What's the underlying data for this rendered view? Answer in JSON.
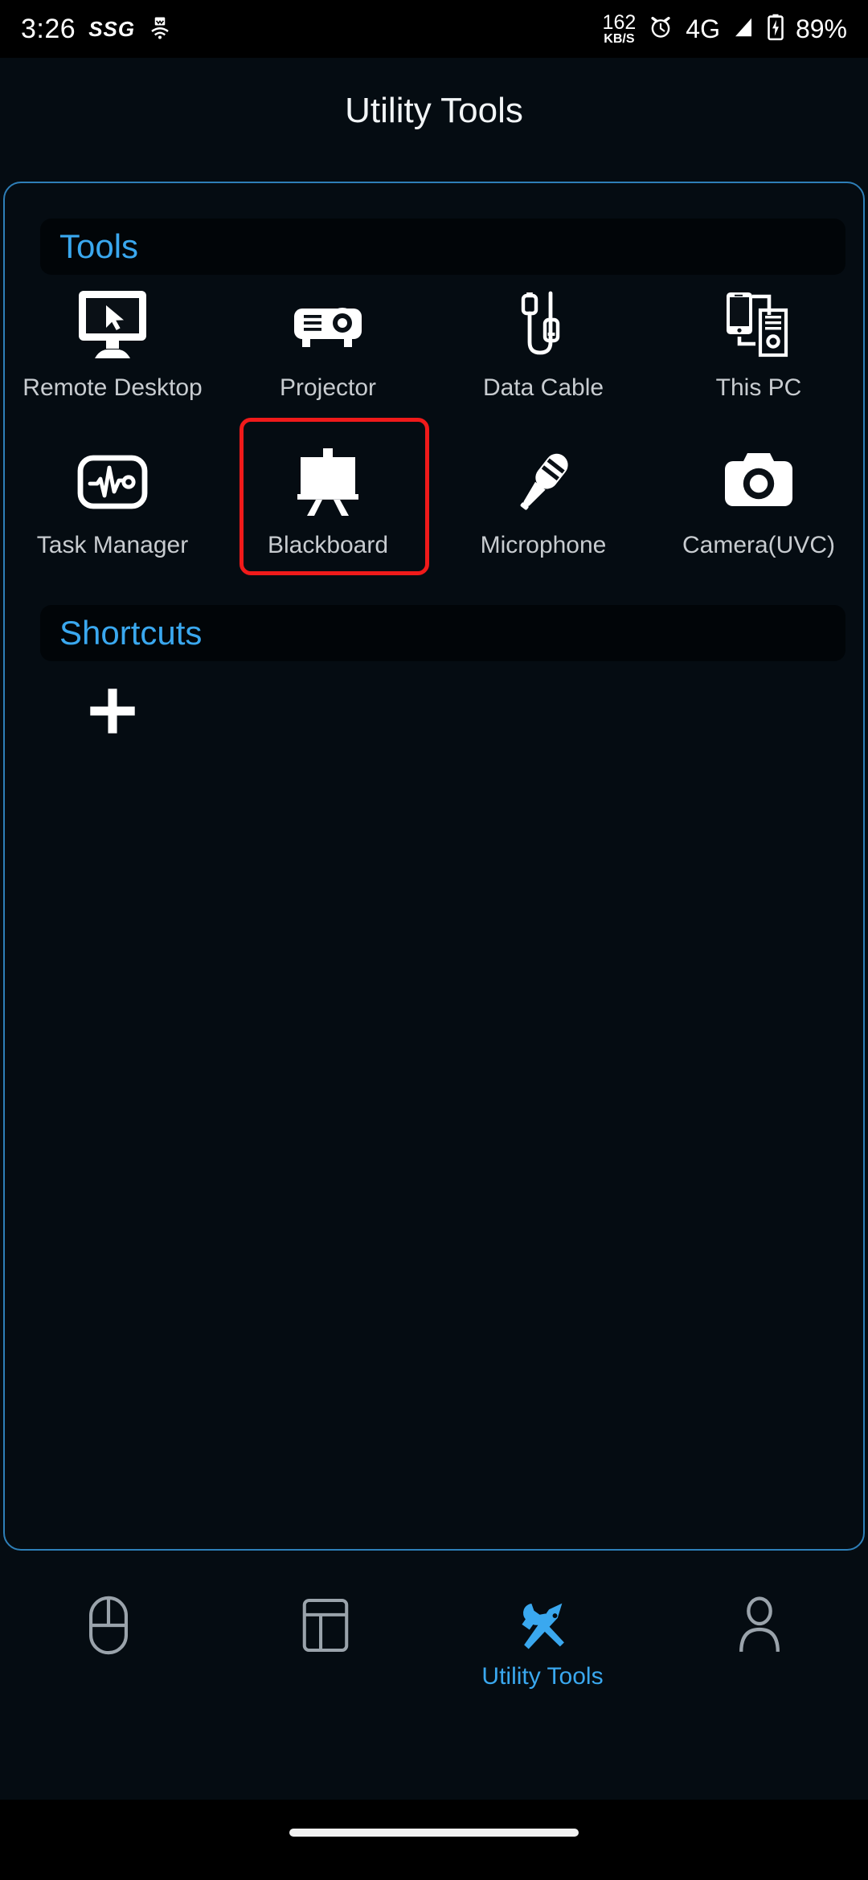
{
  "status_bar": {
    "clock": "3:26",
    "carrier_label": "SSG",
    "hotspot_icon": "hotspot-icon",
    "net_speed_value": "162",
    "net_speed_unit": "KB/S",
    "alarm_icon": "alarm-clock-icon",
    "network_type": "4G",
    "signal_icon": "signal-bars-icon",
    "battery_icon": "battery-charging-icon",
    "battery_percent": "89%"
  },
  "header": {
    "title": "Utility Tools"
  },
  "colors": {
    "accent_blue": "#3aa8ef",
    "card_border": "#2e7fb8",
    "highlight_red": "#f01a1a",
    "background": "#050c12",
    "label_grey": "#c8ccd0"
  },
  "sections": {
    "tools": {
      "title": "Tools",
      "items": [
        {
          "label": "Remote Desktop",
          "icon": "remote-desktop-icon",
          "highlighted": false
        },
        {
          "label": "Projector",
          "icon": "projector-icon",
          "highlighted": false
        },
        {
          "label": "Data Cable",
          "icon": "data-cable-icon",
          "highlighted": false
        },
        {
          "label": "This PC",
          "icon": "this-pc-icon",
          "highlighted": false
        },
        {
          "label": "Task Manager",
          "icon": "task-manager-icon",
          "highlighted": false
        },
        {
          "label": "Blackboard",
          "icon": "blackboard-icon",
          "highlighted": true
        },
        {
          "label": "Microphone",
          "icon": "microphone-icon",
          "highlighted": false
        },
        {
          "label": "Camera(UVC)",
          "icon": "camera-uvc-icon",
          "highlighted": false
        }
      ]
    },
    "shortcuts": {
      "title": "Shortcuts",
      "add_icon": "plus-icon",
      "items": []
    }
  },
  "bottom_nav": {
    "items": [
      {
        "label": "",
        "icon": "mouse-icon",
        "active": false
      },
      {
        "label": "",
        "icon": "layout-panel-icon",
        "active": false
      },
      {
        "label": "Utility Tools",
        "icon": "tools-wrench-icon",
        "active": true
      },
      {
        "label": "",
        "icon": "person-icon",
        "active": false
      }
    ]
  },
  "system": {
    "gesture_bar": "home-gesture-bar"
  }
}
